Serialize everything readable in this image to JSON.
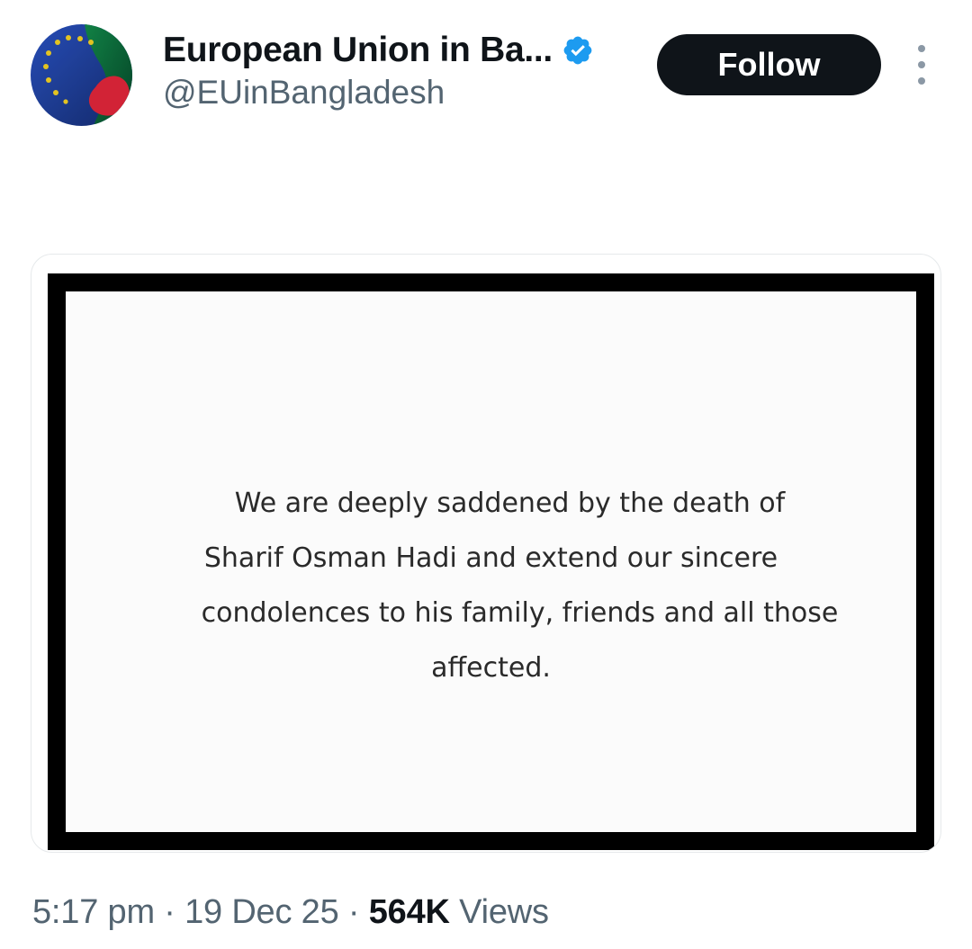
{
  "account": {
    "display_name": "European Union in Ba...",
    "handle": "@EUinBangladesh",
    "avatar_icon": "eu-bangladesh-flag-avatar",
    "verified_icon": "verified-badge-icon",
    "verified_color": "#1d9bf0"
  },
  "actions": {
    "follow_label": "Follow",
    "more_icon": "more-vertical-icon"
  },
  "media": {
    "notice_lines": [
      "We are deeply saddened by the death of",
      "Sharif Osman Hadi and extend our sincere",
      "condolences to his family, friends and all those",
      "affected."
    ]
  },
  "meta": {
    "time": "5:17 pm",
    "separator": "·",
    "date": "19 Dec 25",
    "views_count": "564K",
    "views_label": "Views"
  },
  "colors": {
    "text_primary": "#0f1419",
    "text_secondary": "#536471",
    "button_bg": "#0f1419",
    "eu_blue": "#1e3f9a",
    "eu_star": "#f2d024",
    "bd_green": "#0b6b3a",
    "bd_red": "#e0263a"
  }
}
